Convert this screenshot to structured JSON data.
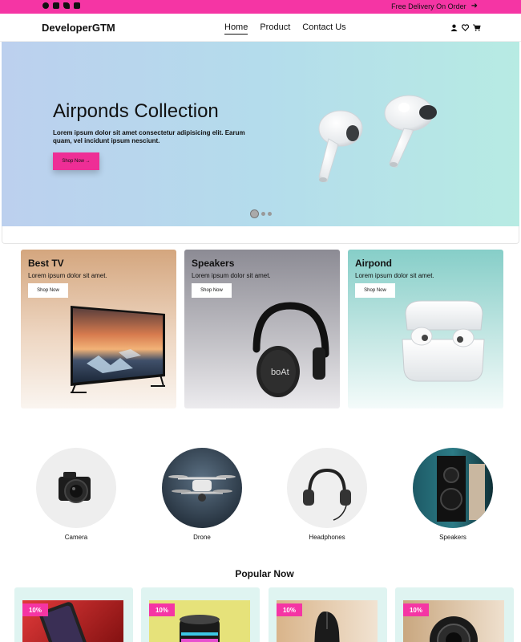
{
  "topbar": {
    "social_icons": [
      "facebook-icon",
      "youtube-icon",
      "twitter-icon",
      "instagram-icon"
    ],
    "promo_text": "Free Delivery On Order",
    "promo_icon": "arrow-right-icon",
    "background": "#f535a4"
  },
  "navbar": {
    "logo": "DeveloperGTM",
    "menu": [
      {
        "label": "Home",
        "active": true
      },
      {
        "label": "Product",
        "active": false
      },
      {
        "label": "Contact Us",
        "active": false
      }
    ],
    "icons": [
      "user-icon",
      "heart-icon",
      "cart-icon"
    ]
  },
  "hero": {
    "title": "Airponds Collection",
    "text": "Lorem ipsum dolor sit amet consectetur adipisicing elit. Earum quam, vel incidunt ipsum nesciunt.",
    "button": "Shop Now →",
    "slide_count": 3,
    "active_slide": 1
  },
  "cards": [
    {
      "title": "Best TV",
      "text": "Lorem ipsum dolor sit amet.",
      "button": "Shop Now",
      "image": "tv-image"
    },
    {
      "title": "Speakers",
      "text": "Lorem ipsum dolor sit amet.",
      "button": "Shop Now",
      "image": "headphones-image"
    },
    {
      "title": "Airpond",
      "text": "Lorem ipsum dolor sit amet.",
      "button": "Shop Now",
      "image": "airpods-case-image"
    }
  ],
  "categories": [
    {
      "label": "Camera",
      "image": "camera-image"
    },
    {
      "label": "Drone",
      "image": "drone-image"
    },
    {
      "label": "Headphones",
      "image": "headphones-image"
    },
    {
      "label": "Speakers",
      "image": "speaker-image"
    }
  ],
  "popular": {
    "heading": "Popular Now",
    "products": [
      {
        "badge": "10%",
        "image": "phone-image"
      },
      {
        "badge": "10%",
        "image": "speaker-image"
      },
      {
        "badge": "10%",
        "image": "mouse-image"
      },
      {
        "badge": "10%",
        "image": "camera-lens-image"
      }
    ]
  },
  "colors": {
    "accent": "#f535a4",
    "button": "#ee2e96"
  }
}
